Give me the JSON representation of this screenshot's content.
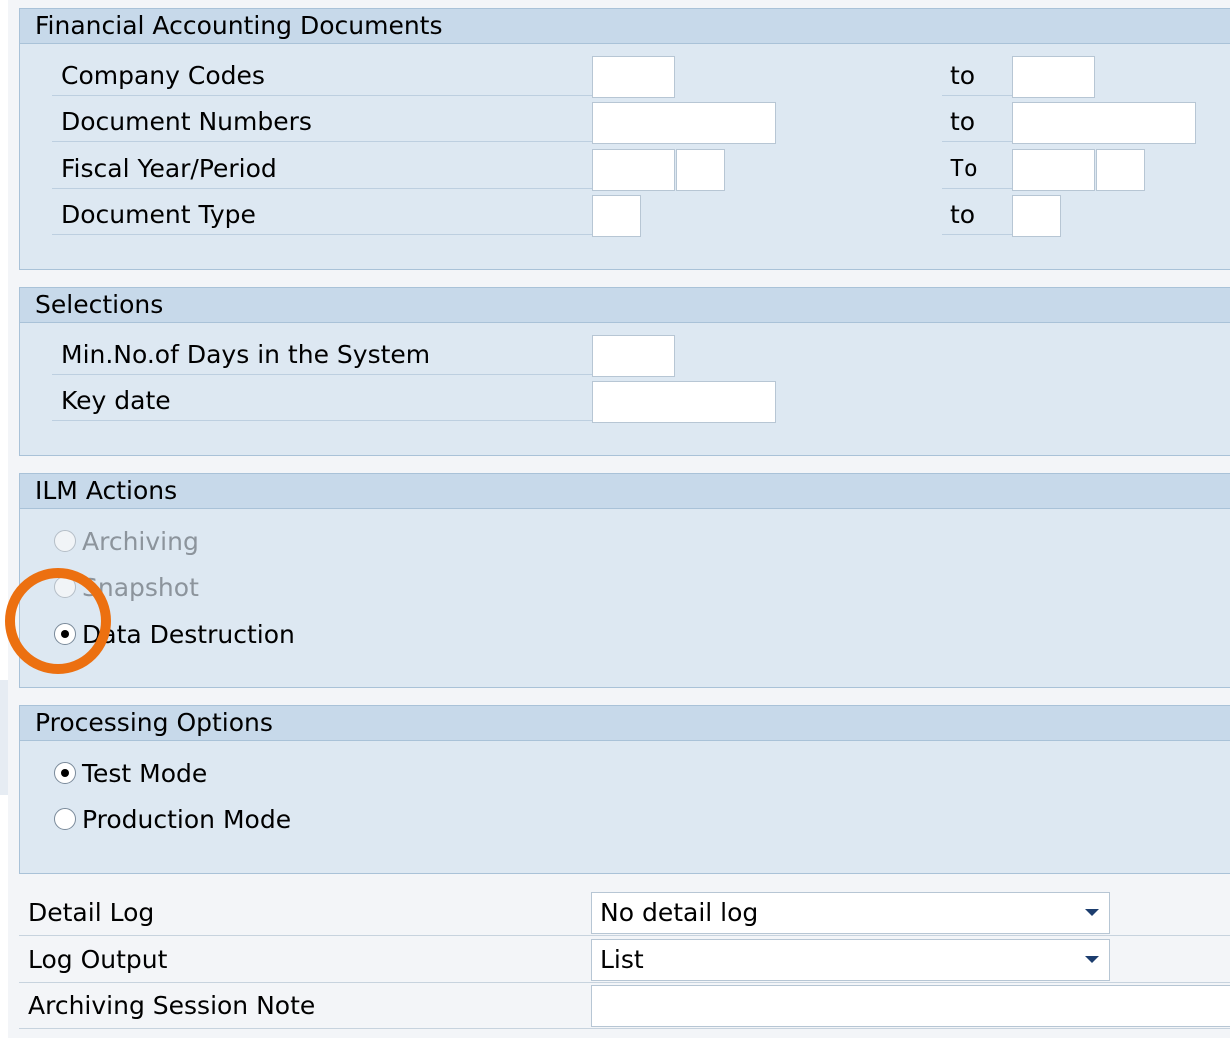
{
  "sections": {
    "fad": {
      "title": "Financial Accounting Documents",
      "rows": [
        {
          "label": "Company Codes",
          "to": "to"
        },
        {
          "label": "Document Numbers",
          "to": "to"
        },
        {
          "label": "Fiscal Year/Period",
          "to": "To"
        },
        {
          "label": "Document Type",
          "to": "to"
        }
      ]
    },
    "selections": {
      "title": "Selections",
      "rows": [
        {
          "label": "Min.No.of Days in the System"
        },
        {
          "label": "Key date"
        }
      ]
    },
    "ilm": {
      "title": "ILM Actions",
      "options": [
        {
          "label": "Archiving",
          "checked": false,
          "disabled": true
        },
        {
          "label": "Snapshot",
          "checked": false,
          "disabled": true
        },
        {
          "label": "Data Destruction",
          "checked": true,
          "disabled": false
        }
      ]
    },
    "processing": {
      "title": "Processing Options",
      "options": [
        {
          "label": "Test Mode",
          "checked": true
        },
        {
          "label": "Production Mode",
          "checked": false
        }
      ]
    }
  },
  "bottom": {
    "detail_log": {
      "label": "Detail Log",
      "value": "No detail log"
    },
    "log_output": {
      "label": "Log Output",
      "value": "List"
    },
    "session_note": {
      "label": "Archiving Session Note",
      "value": ""
    }
  },
  "annotation": {
    "color": "#ec7010",
    "target": "Data Destruction"
  }
}
